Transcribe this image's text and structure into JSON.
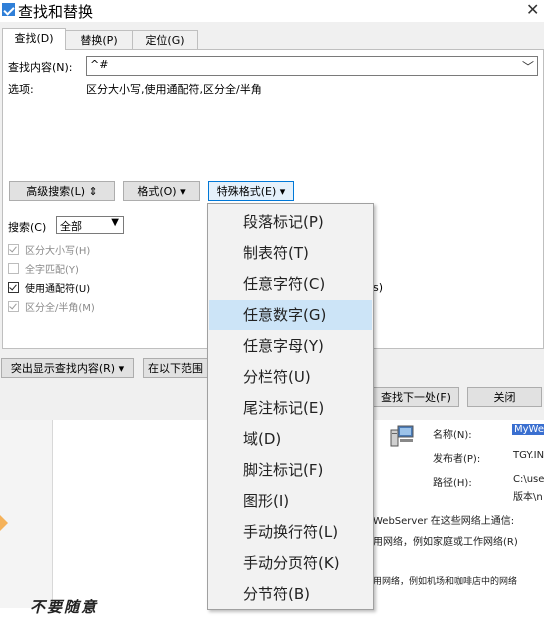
{
  "window": {
    "title": "查找和替换",
    "close": "✕"
  },
  "tabs": [
    {
      "label": "查找(D)",
      "active": true
    },
    {
      "label": "替换(P)",
      "active": false
    },
    {
      "label": "定位(G)",
      "active": false
    }
  ],
  "find": {
    "label": "查找内容(N):",
    "value": "^#"
  },
  "options": {
    "label": "选项:",
    "value": "区分大小写,使用通配符,区分全/半角"
  },
  "buttons": {
    "advanced": "高级搜索(L) ⇕",
    "format": "格式(O) ▾",
    "special": "特殊格式(E) ▾",
    "highlight": "突出显示查找内容(R) ▾",
    "find_in": "在以下范围",
    "find_next": "查找下一处(F)",
    "close": "关闭"
  },
  "search": {
    "label": "搜索(C)",
    "value": "全部"
  },
  "checkboxes": [
    {
      "label": "区分大小写(H)",
      "checked": true,
      "disabled": true
    },
    {
      "label": "全字匹配(Y)",
      "checked": false,
      "disabled": true
    },
    {
      "label": "使用通配符(U)",
      "checked": true,
      "disabled": false
    },
    {
      "label": "区分全/半角(M)",
      "checked": true,
      "disabled": true
    }
  ],
  "partial_s": "s)",
  "special_menu": [
    "段落标记(P)",
    "制表符(T)",
    "任意字符(C)",
    "任意数字(G)",
    "任意字母(Y)",
    "分栏符(U)",
    "尾注标记(E)",
    "域(D)",
    "脚注标记(F)",
    "图形(I)",
    "手动换行符(L)",
    "手动分页符(K)",
    "分节符(B)"
  ],
  "highlighted_item": 3,
  "background": {
    "name_label": "名称(N):",
    "name_value": "MyWe",
    "publisher_label": "发布者(P):",
    "publisher_value": "TGY.IN",
    "path_label": "路径(H):",
    "path_value": "C:\\use",
    "version_value": "版本\\n",
    "webserver_text": "WebServer 在这些网络上通信:",
    "private_text": "用网络，例如家庭或工作网络(R)",
    "public_text": "用网络，例如机场和咖啡店中的网络",
    "cn_title": "不要随意"
  },
  "colors": {
    "accent": "#0078d7",
    "highlight": "#cce4f7",
    "dialog_bg": "#f0f0f0"
  }
}
